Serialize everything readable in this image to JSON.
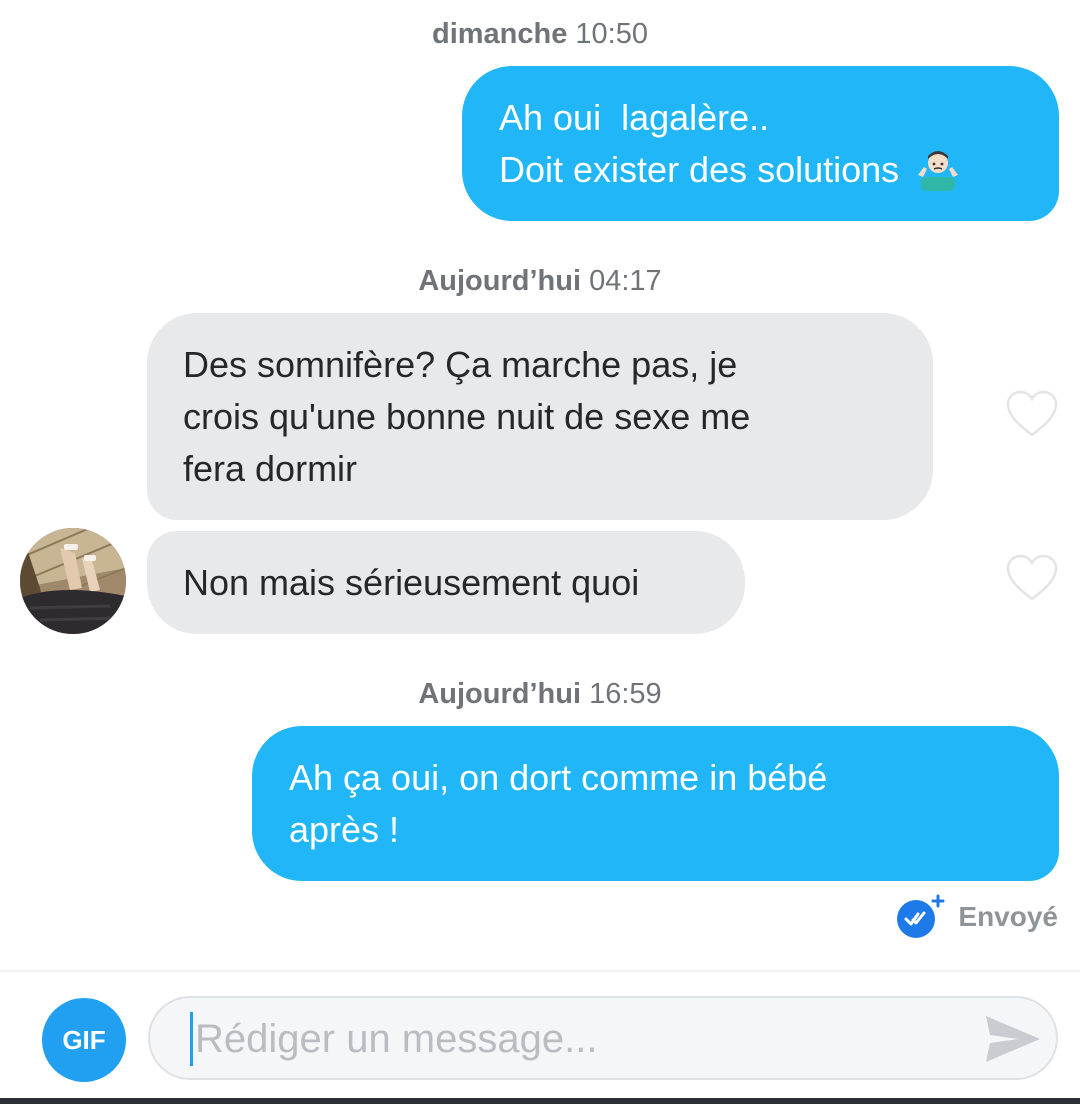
{
  "conversation": {
    "groups": [
      {
        "timestamp": {
          "day": "dimanche",
          "time": "10:50"
        },
        "messages": [
          {
            "direction": "sent",
            "lines": [
              "Ah oui  lagalère..",
              "Doit exister des solutions"
            ],
            "emoji": "person-shrugging-emoji"
          }
        ]
      },
      {
        "timestamp": {
          "day": "Aujourd’hui",
          "time": "04:17"
        },
        "messages": [
          {
            "direction": "received",
            "lines": [
              "Des somnifère? Ça marche pas, je",
              "crois qu'une bonne nuit de sexe me",
              "fera dormir"
            ]
          },
          {
            "direction": "received",
            "lines": [
              "Non mais sérieusement quoi"
            ]
          }
        ]
      },
      {
        "timestamp": {
          "day": "Aujourd’hui",
          "time": "16:59"
        },
        "messages": [
          {
            "direction": "sent",
            "lines": [
              "Ah ça oui, on dort comme in bébé",
              "après !"
            ]
          }
        ]
      }
    ],
    "status": {
      "label": "Envoyé",
      "icon": "double-check-icon"
    }
  },
  "composer": {
    "gif_label": "GIF",
    "placeholder": "Rédiger un message...",
    "send_icon": "send-arrow-icon"
  },
  "colors": {
    "sent_bubble": "#21b6f7",
    "received_bubble": "#e8e9eb",
    "gif_button": "#21a0f2",
    "timestamp_text": "#707479"
  }
}
